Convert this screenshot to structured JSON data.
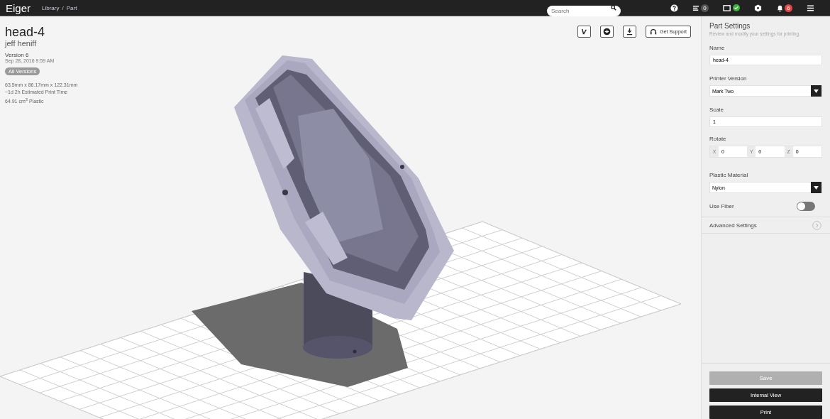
{
  "app": {
    "name": "Eiger"
  },
  "breadcrumb": {
    "items": [
      "Library",
      "Part"
    ],
    "separator": "/"
  },
  "search": {
    "placeholder": "Search"
  },
  "nav": {
    "queue_count": "0",
    "printer_online": true,
    "notification_count": "6"
  },
  "part": {
    "title": "head-4",
    "owner": "jeff heniff",
    "version": "Version 6",
    "date": "Sep 28, 2016 9:59 AM",
    "versions_badge": "All Versions",
    "stats": [
      "63.5mm x 86.17mm x 122.31mm",
      "~1d 2h Estimated Print Time",
      "64.91 cm$^{3}$ Plastic"
    ]
  },
  "toolbar": {
    "support": "Get Support"
  },
  "settings": {
    "title": "Part Settings",
    "subtitle": "Review and modify your settings for printing.",
    "name": {
      "label": "Name",
      "value": "head-4"
    },
    "printer_version": {
      "label": "Printer Version",
      "value": "Mark Two"
    },
    "scale": {
      "label": "Scale",
      "value": "1"
    },
    "rotate": {
      "label": "Rotate",
      "axes": [
        {
          "axis": "X",
          "value": "0"
        },
        {
          "axis": "Y",
          "value": "0"
        },
        {
          "axis": "Z",
          "value": "0"
        }
      ]
    },
    "material": {
      "label": "Plastic Material",
      "value": "Nylon"
    },
    "use_fiber": {
      "label": "Use Fiber",
      "on": false
    },
    "advanced": "Advanced Settings",
    "buttons": [
      {
        "label": "Save",
        "disabled": true
      },
      {
        "label": "Internal View",
        "disabled": false
      },
      {
        "label": "Print",
        "disabled": false
      }
    ]
  }
}
